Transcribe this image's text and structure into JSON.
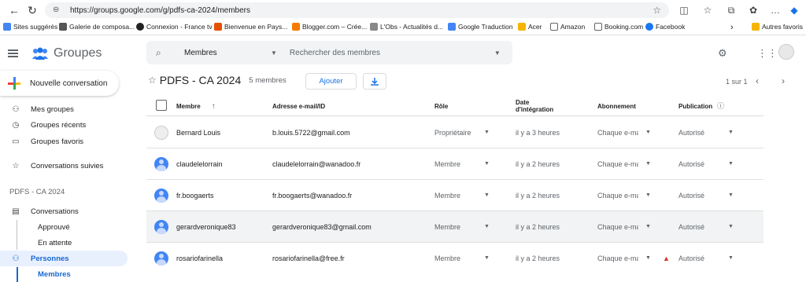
{
  "browser": {
    "url": "https://groups.google.com/g/pdfs-ca-2024/members",
    "bookmarks": [
      {
        "label": "Sites suggérés",
        "color": "#4285f4"
      },
      {
        "label": "Galerie de composa...",
        "color": "#555555"
      },
      {
        "label": "Connexion - France tv",
        "color": "#222222"
      },
      {
        "label": "Bienvenue en Pays...",
        "color": "#e65100"
      },
      {
        "label": "Blogger.com – Crée...",
        "color": "#f57c00"
      },
      {
        "label": "L'Obs - Actualités d...",
        "color": "#888888"
      },
      {
        "label": "Google Traduction",
        "color": "#4285f4"
      },
      {
        "label": "Acer",
        "color": "#f4b400"
      },
      {
        "label": "Amazon",
        "color": "#666666"
      },
      {
        "label": "Booking.com",
        "color": "#666666"
      },
      {
        "label": "Facebook",
        "color": "#1877f2"
      },
      {
        "label": "Autres favoris",
        "color": "#f4b400"
      }
    ]
  },
  "app": {
    "name": "Groupes"
  },
  "sidebar": {
    "new_conversation": "Nouvelle conversation",
    "items": [
      {
        "label": "Mes groupes",
        "icon": "people-icon"
      },
      {
        "label": "Groupes récents",
        "icon": "clock-icon"
      },
      {
        "label": "Groupes favoris",
        "icon": "folder-star-icon"
      },
      {
        "label": "Conversations suivies",
        "icon": "star-icon"
      }
    ],
    "group_section": "PDFS - CA 2024",
    "conversations": "Conversations",
    "approved": "Approuvé",
    "pending": "En attente",
    "people": "Personnes",
    "members": "Membres"
  },
  "search": {
    "scope": "Membres",
    "placeholder": "Rechercher des membres"
  },
  "group": {
    "name": "PDFS - CA 2024",
    "member_count": "5 membres",
    "add_label": "Ajouter",
    "pager": "1 sur 1"
  },
  "table": {
    "headers": {
      "member": "Membre",
      "email": "Adresse e-mail/ID",
      "role": "Rôle",
      "date_line1": "Date",
      "date_line2": "d'intégration",
      "subscription": "Abonnement",
      "publication": "Publication"
    },
    "rows": [
      {
        "name": "Bernard Louis",
        "email": "b.louis.5722@gmail.com",
        "role": "Propriétaire",
        "joined": "il y a 3 heures",
        "subscription": "Chaque e-ma",
        "publication": "Autorisé",
        "warn": false
      },
      {
        "name": "claudelelorrain",
        "email": "claudelelorrain@wanadoo.fr",
        "role": "Membre",
        "joined": "il y a 2 heures",
        "subscription": "Chaque e-ma",
        "publication": "Autorisé",
        "warn": false
      },
      {
        "name": "fr.boogaerts",
        "email": "fr.boogaerts@wanadoo.fr",
        "role": "Membre",
        "joined": "il y a 2 heures",
        "subscription": "Chaque e-ma",
        "publication": "Autorisé",
        "warn": false
      },
      {
        "name": "gerardveronique83",
        "email": "gerardveronique83@gmail.com",
        "role": "Membre",
        "joined": "il y a 2 heures",
        "subscription": "Chaque e-ma",
        "publication": "Autorisé",
        "warn": false
      },
      {
        "name": "rosariofarinella",
        "email": "rosariofarinella@free.fr",
        "role": "Membre",
        "joined": "il y a 2 heures",
        "subscription": "Chaque e-ma",
        "publication": "Autorisé",
        "warn": true
      }
    ]
  },
  "colors": {
    "accent": "#1a73e8",
    "active_bg": "#e8f0fe",
    "warn": "#d93025"
  }
}
